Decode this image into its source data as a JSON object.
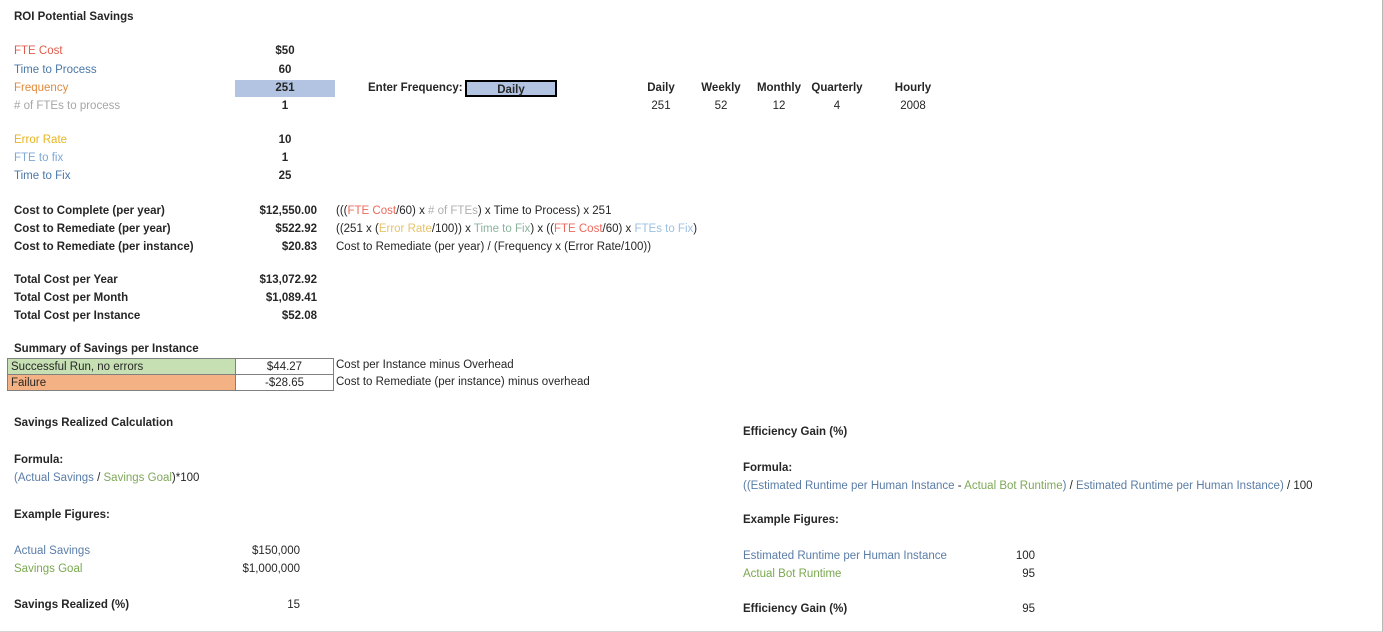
{
  "title": "ROI Potential Savings",
  "inputs": {
    "rows": [
      {
        "label": "FTE Cost",
        "value": "$50"
      },
      {
        "label": "Time to Process",
        "value": "60"
      },
      {
        "label": "Frequency",
        "value": "251"
      },
      {
        "label": "# of FTEs to process",
        "value": "1"
      }
    ],
    "error_rows": [
      {
        "label": "Error Rate",
        "value": "10"
      },
      {
        "label": "FTE to fix",
        "value": "1"
      },
      {
        "label": "Time to Fix",
        "value": "25"
      }
    ]
  },
  "frequency_selector": {
    "label": "Enter Frequency:",
    "selected": "Daily",
    "options": [
      "Daily",
      "Weekly",
      "Monthly",
      "Quarterly",
      "Hourly"
    ]
  },
  "frequency_table": {
    "headers": [
      "Daily",
      "Weekly",
      "Monthly",
      "Quarterly",
      "Hourly"
    ],
    "values": [
      "251",
      "52",
      "12",
      "4",
      "2008"
    ]
  },
  "costs": {
    "rows": [
      {
        "label": "Cost to Complete (per year)",
        "value": "$12,550.00",
        "formula_parts": [
          {
            "t": "(((",
            "c": "dark"
          },
          {
            "t": "FTE Cost",
            "c": "red"
          },
          {
            "t": "/60) x ",
            "c": "dark"
          },
          {
            "t": "# of FTEs",
            "c": "gray"
          },
          {
            "t": ") x ",
            "c": "dark"
          },
          {
            "t": "Time to Process",
            "c": "dark"
          },
          {
            "t": ") x 251",
            "c": "dark"
          }
        ]
      },
      {
        "label": "Cost to Remediate (per year)",
        "value": "$522.92",
        "formula_parts": [
          {
            "t": "((251 x (",
            "c": "dark"
          },
          {
            "t": "Error Rate",
            "c": "gold"
          },
          {
            "t": "/100)) x ",
            "c": "dark"
          },
          {
            "t": "Time to Fix",
            "c": "teal"
          },
          {
            "t": ") x ((",
            "c": "dark"
          },
          {
            "t": "FTE Cost",
            "c": "red"
          },
          {
            "t": "/60) x ",
            "c": "dark"
          },
          {
            "t": "FTEs to Fix",
            "c": "ltblue"
          },
          {
            "t": ")",
            "c": "dark"
          }
        ]
      },
      {
        "label": "Cost to Remediate (per instance)",
        "value": "$20.83",
        "formula_parts": [
          {
            "t": "Cost to Remediate (per year) / (Frequency x (Error Rate/100))",
            "c": "dark"
          }
        ]
      }
    ]
  },
  "totals": {
    "rows": [
      {
        "label": "Total Cost per Year",
        "value": "$13,072.92"
      },
      {
        "label": "Total Cost per Month",
        "value": "$1,089.41"
      },
      {
        "label": "Total Cost per Instance",
        "value": "$52.08"
      }
    ]
  },
  "summary": {
    "title": "Summary of Savings per Instance",
    "rows": [
      {
        "label": "Successful Run, no errors",
        "value": "$44.27",
        "note": "Cost per Instance minus Overhead"
      },
      {
        "label": "Failure",
        "value": "-$28.65",
        "note": "Cost to Remediate (per instance) minus overhead"
      }
    ]
  },
  "savings_section": {
    "title": "Savings Realized Calculation",
    "formula_label": "Formula:",
    "formula_parts": [
      {
        "t": "(",
        "c": "blue"
      },
      {
        "t": "Actual Savings",
        "c": "blue"
      },
      {
        "t": " / ",
        "c": "dark"
      },
      {
        "t": "Savings Goal",
        "c": "green"
      },
      {
        "t": ")*100",
        "c": "dark"
      }
    ],
    "example_label": "Example Figures:",
    "examples": [
      {
        "label": "Actual Savings",
        "value": "$150,000",
        "color": "blue"
      },
      {
        "label": "Savings Goal",
        "value": "$1,000,000",
        "color": "green"
      }
    ],
    "result_label": "Savings Realized (%)",
    "result_value": "15"
  },
  "efficiency_section": {
    "title": "Efficiency Gain (%)",
    "formula_label": "Formula:",
    "formula_parts": [
      {
        "t": "((",
        "c": "blue"
      },
      {
        "t": "Estimated Runtime per Human Instance",
        "c": "blue"
      },
      {
        "t": " - ",
        "c": "dark"
      },
      {
        "t": "Actual Bot Runtime",
        "c": "green"
      },
      {
        "t": ")",
        "c": "blue"
      },
      {
        "t": " / ",
        "c": "dark"
      },
      {
        "t": "Estimated Runtime per Human Instance",
        "c": "blue"
      },
      {
        "t": ")",
        "c": "blue"
      },
      {
        "t": " / 100",
        "c": "dark"
      }
    ],
    "example_label": "Example Figures:",
    "examples": [
      {
        "label": "Estimated Runtime per Human Instance",
        "value": "100",
        "color": "blue"
      },
      {
        "label": "Actual Bot Runtime",
        "value": "95",
        "color": "green"
      }
    ],
    "result_label": "Efficiency Gain (%)",
    "result_value": "95"
  },
  "colors": {
    "fte_cost": "#e05b4b",
    "time_to_process": "#4a77a8",
    "frequency": "#e08a3c",
    "num_ftes": "#a6a6a6",
    "error_rate": "#e6b422",
    "fte_to_fix": "#7fa8d4",
    "time_to_fix": "#4a77a8",
    "highlight": "#b3c4e3",
    "success_row": "#c6e0b4",
    "failure_row": "#f4b183"
  }
}
